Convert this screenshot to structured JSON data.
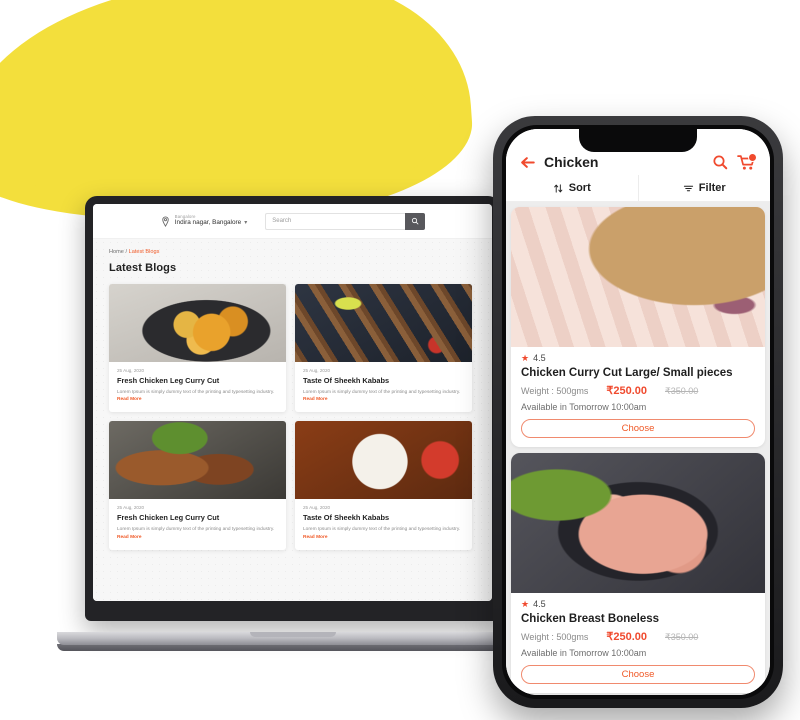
{
  "laptop": {
    "header": {
      "location": {
        "city_label": "Bangalore",
        "address": "Indira nagar, Bangalore",
        "chevron": "chevron-down"
      },
      "search": {
        "placeholder": "Search",
        "value": "",
        "button_icon": "search-icon"
      }
    },
    "breadcrumb": {
      "home": "Home",
      "separator": "/",
      "current": "Latest Blogs"
    },
    "page_title": "Latest Blogs",
    "blog_cards": [
      {
        "date": "25 Aug, 2020",
        "title": "Fresh Chicken Leg Curry Cut",
        "excerpt": "Lorem Ipsum is simply dummy text of the printing and typesetting industry.",
        "read_more": "Read More",
        "art": "art-curry"
      },
      {
        "date": "25 Aug, 2020",
        "title": "Taste Of Sheekh Kababs",
        "excerpt": "Lorem Ipsum is simply dummy text of the printing and typesetting industry.",
        "read_more": "Read More",
        "art": "art-kabab"
      },
      {
        "date": "25 Aug, 2020",
        "title": "Fresh Chicken Leg Curry Cut",
        "excerpt": "Lorem Ipsum is simply dummy text of the printing and typesetting industry.",
        "read_more": "Read More",
        "art": "art-grill"
      },
      {
        "date": "25 Aug, 2020",
        "title": "Taste Of Sheekh Kababs",
        "excerpt": "Lorem Ipsum is simply dummy text of the printing and typesetting industry.",
        "read_more": "Read More",
        "art": "art-wings"
      }
    ]
  },
  "phone": {
    "header": {
      "back_icon": "arrow-left-icon",
      "title": "Chicken",
      "search_icon": "search-icon",
      "cart_icon": "cart-icon",
      "cart_badge": ""
    },
    "tools": [
      {
        "label": "Sort",
        "icon": "sort-arrows-icon"
      },
      {
        "label": "Filter",
        "icon": "filter-lines-icon"
      }
    ],
    "products": [
      {
        "rating": "4.5",
        "name": "Chicken Curry Cut Large/ Small pieces",
        "weight": "Weight : 500gms",
        "price": "₹250.00",
        "mrp": "₹350.00",
        "availability": "Available in Tomorrow 10:00am",
        "cta": "Choose",
        "art": "art-drum"
      },
      {
        "rating": "4.5",
        "name": "Chicken Breast Boneless",
        "weight": "Weight : 500gms",
        "price": "₹250.00",
        "mrp": "₹350.00",
        "availability": "Available in Tomorrow 10:00am",
        "cta": "Choose",
        "art": "art-breast"
      }
    ]
  },
  "theme": {
    "accent": "#F05A28",
    "accent_red": "#F04A2E",
    "blob_yellow": "#F3DF3C",
    "device_dark": "#232326"
  }
}
